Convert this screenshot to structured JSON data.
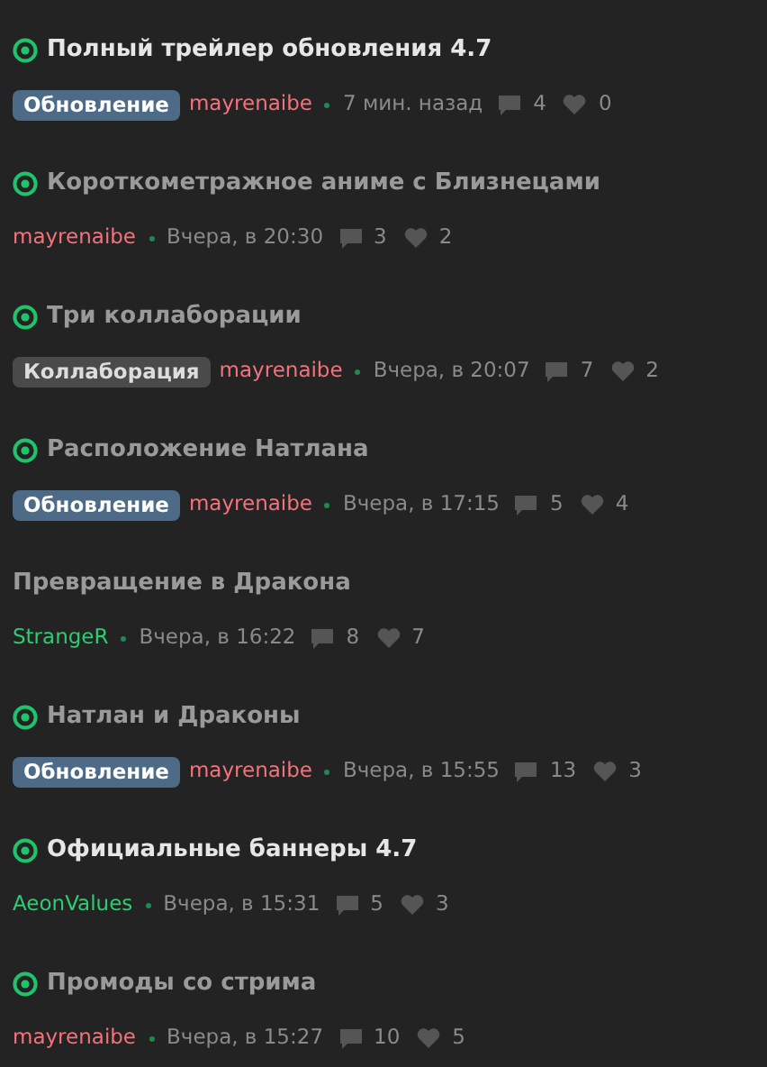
{
  "posts": [
    {
      "title": "Полный трейлер обновления 4.7",
      "pinned": true,
      "unread": true,
      "tag": {
        "label": "Обновление",
        "kind": "update"
      },
      "author": {
        "name": "mayrenaibe",
        "color": "#f2737c"
      },
      "time": "7 мин. назад",
      "comments": "4",
      "likes": "0"
    },
    {
      "title": "Короткометражное аниме с Близнецами",
      "pinned": true,
      "unread": false,
      "author": {
        "name": "mayrenaibe",
        "color": "#f2737c"
      },
      "time": "Вчера, в 20:30",
      "comments": "3",
      "likes": "2"
    },
    {
      "title": "Три коллаборации",
      "pinned": true,
      "unread": false,
      "tag": {
        "label": "Коллаборация",
        "kind": "collab"
      },
      "author": {
        "name": "mayrenaibe",
        "color": "#f2737c"
      },
      "time": "Вчера, в 20:07",
      "comments": "7",
      "likes": "2"
    },
    {
      "title": "Расположение Натлана",
      "pinned": true,
      "unread": false,
      "tag": {
        "label": "Обновление",
        "kind": "update"
      },
      "author": {
        "name": "mayrenaibe",
        "color": "#f2737c"
      },
      "time": "Вчера, в 17:15",
      "comments": "5",
      "likes": "4"
    },
    {
      "title": "Превращение в Дракона",
      "pinned": false,
      "unread": false,
      "author": {
        "name": "StrangeR",
        "color": "#2ecc71"
      },
      "time": "Вчера, в 16:22",
      "comments": "8",
      "likes": "7"
    },
    {
      "title": "Натлан и Драконы",
      "pinned": true,
      "unread": false,
      "tag": {
        "label": "Обновление",
        "kind": "update"
      },
      "author": {
        "name": "mayrenaibe",
        "color": "#f2737c"
      },
      "time": "Вчера, в 15:55",
      "comments": "13",
      "likes": "3"
    },
    {
      "title": "Официальные баннеры 4.7",
      "pinned": true,
      "unread": true,
      "author": {
        "name": "AeonValues",
        "color": "#2ecc71"
      },
      "time": "Вчера, в 15:31",
      "comments": "5",
      "likes": "3"
    },
    {
      "title": "Промоды со стрима",
      "pinned": true,
      "unread": false,
      "author": {
        "name": "mayrenaibe",
        "color": "#f2737c"
      },
      "time": "Вчера, в 15:27",
      "comments": "10",
      "likes": "5"
    }
  ]
}
